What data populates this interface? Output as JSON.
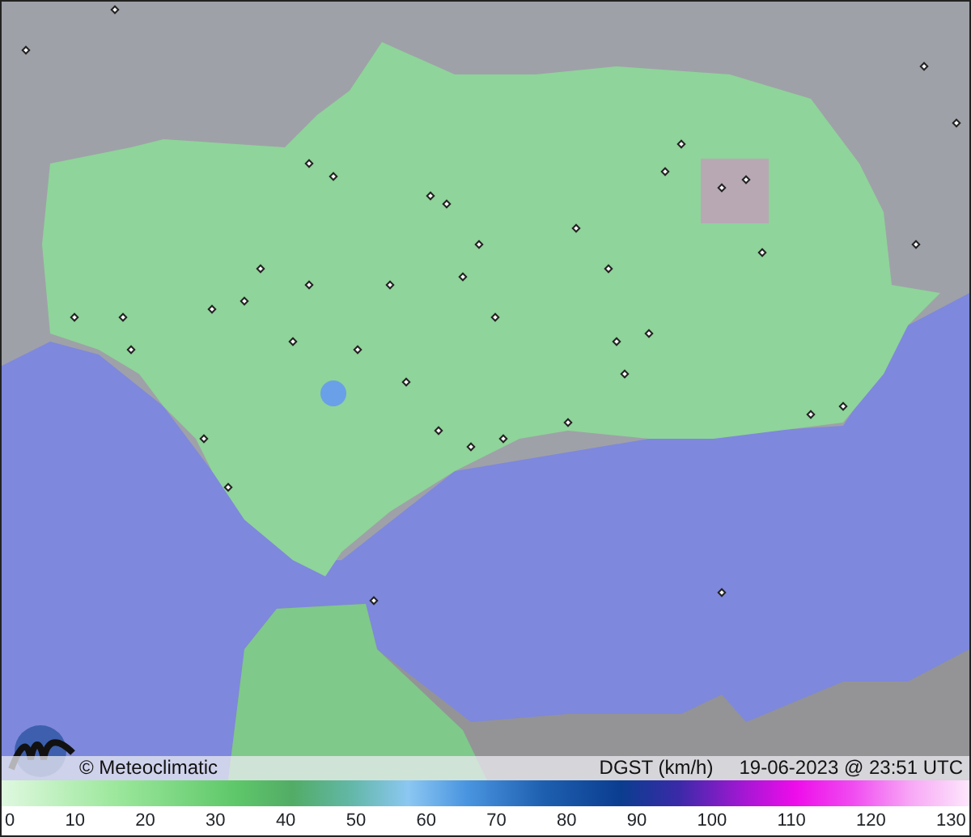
{
  "map": {
    "credit": "© Meteoclimatic",
    "variable": "DGST (km/h)",
    "timestamp": "19-06-2023 @ 23:51 UTC"
  },
  "legend": {
    "ticks": [
      "0",
      "10",
      "20",
      "30",
      "40",
      "50",
      "60",
      "70",
      "80",
      "90",
      "100",
      "110",
      "120",
      "130"
    ]
  }
}
